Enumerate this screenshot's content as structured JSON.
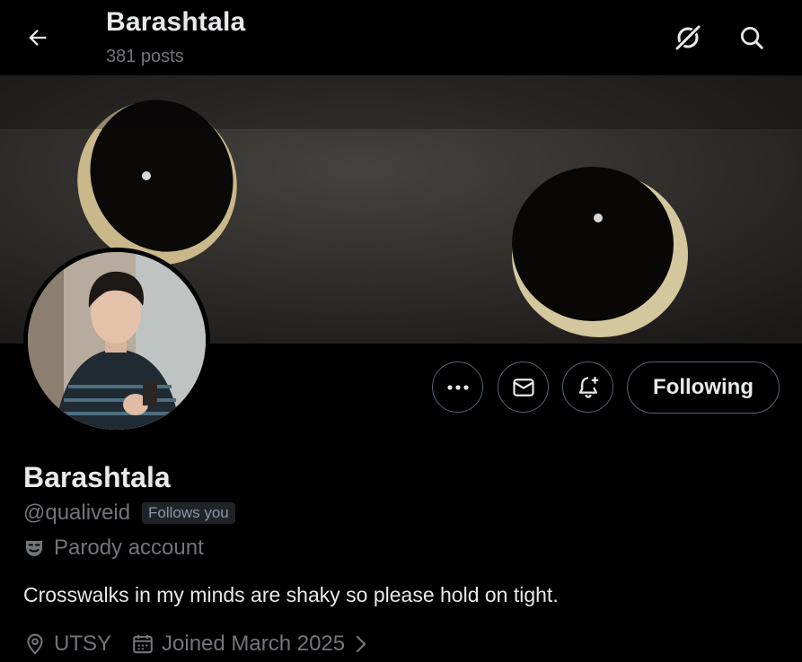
{
  "header": {
    "title": "Barashtala",
    "posts_count": "381 posts",
    "icons": [
      "back-arrow-icon",
      "grok-icon",
      "search-icon"
    ]
  },
  "profile": {
    "display_name": "Barashtala",
    "handle": "@qualiveid",
    "follows_you": "Follows you",
    "parody_label": "Parody account",
    "bio": "Crosswalks in my minds are shaky so please hold on tight.",
    "location": "UTSY",
    "joined": "Joined March 2025"
  },
  "actions": {
    "more_icon": "more-icon",
    "message_icon": "envelope-icon",
    "notify_icon": "bell-plus-icon",
    "following_label": "Following"
  },
  "colors": {
    "background": "#000000",
    "text_primary": "#e7e9ea",
    "text_secondary": "#71767b",
    "border": "#536471",
    "badge_bg": "#202327"
  }
}
